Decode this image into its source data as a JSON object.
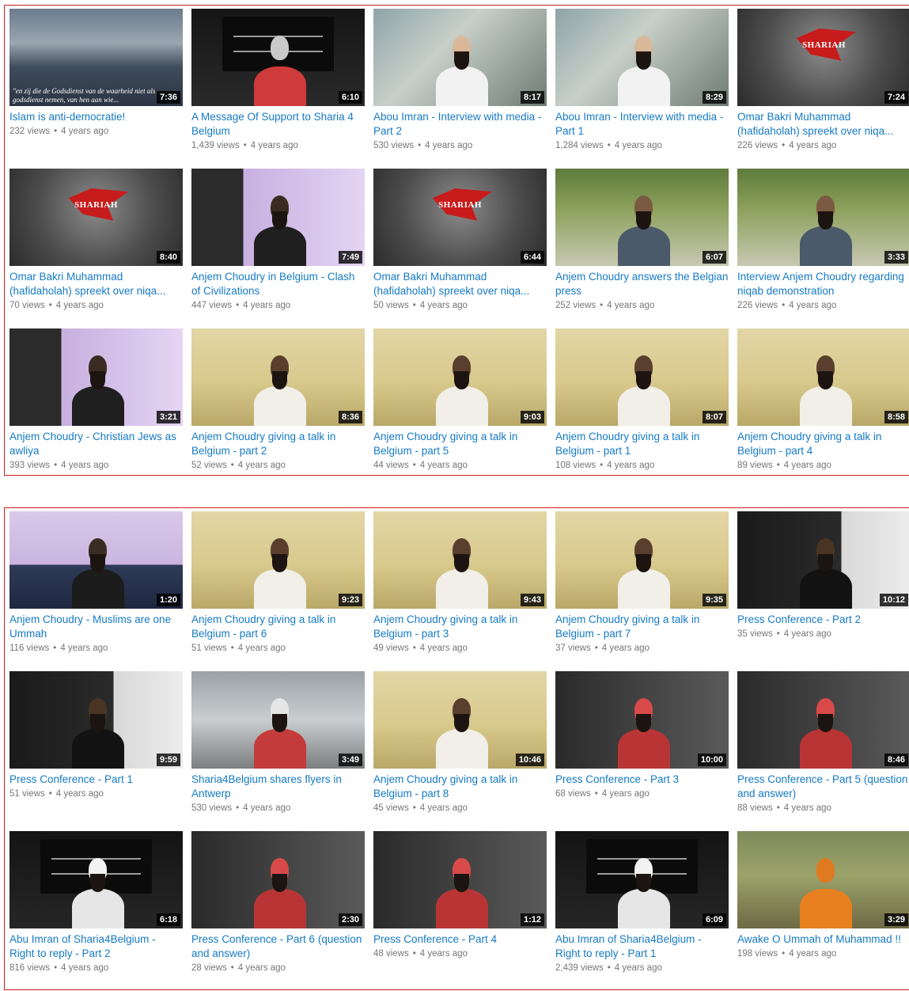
{
  "colors": {
    "border": "#cc1f1f",
    "link": "#167ac6",
    "meta": "#767676",
    "duration_bg": "#000000"
  },
  "sections": [
    {
      "videos": [
        {
          "title": "Islam is anti-democratie!",
          "views": "232 views",
          "age": "4 years ago",
          "duration": "7:36",
          "thumb": "parliament",
          "caption": "\"en zij die de Godsdienst van de waarheid niet als godsdienst nemen, van hen aan wie..."
        },
        {
          "title": "A Message Of Support to Sharia 4 Belgium",
          "views": "1,439 views",
          "age": "4 years ago",
          "duration": "6:10",
          "thumb": "flag-red-scarf"
        },
        {
          "title": "Abou Imran - Interview with media - Part 2",
          "views": "530 views",
          "age": "4 years ago",
          "duration": "8:17",
          "thumb": "interview-street"
        },
        {
          "title": "Abou Imran - Interview with media - Part 1",
          "views": "1,284 views",
          "age": "4 years ago",
          "duration": "8:29",
          "thumb": "interview-street"
        },
        {
          "title": "Omar Bakri Muhammad (hafidaholah) spreekt over niqa...",
          "views": "226 views",
          "age": "4 years ago",
          "duration": "7:24",
          "thumb": "logo",
          "logo_text": "SHARIAH"
        },
        {
          "title": "Omar Bakri Muhammad (hafidaholah) spreekt over niqa...",
          "views": "70 views",
          "age": "4 years ago",
          "duration": "8:40",
          "thumb": "logo",
          "logo_text": "SHARIAH"
        },
        {
          "title": "Anjem Choudry in Belgium - Clash of Civilizations",
          "views": "447 views",
          "age": "4 years ago",
          "duration": "7:49",
          "thumb": "purple-room"
        },
        {
          "title": "Omar Bakri Muhammad (hafidaholah) spreekt over niqa...",
          "views": "50 views",
          "age": "4 years ago",
          "duration": "6:44",
          "thumb": "logo",
          "logo_text": "SHARIAH"
        },
        {
          "title": "Anjem Choudry answers the Belgian press",
          "views": "252 views",
          "age": "4 years ago",
          "duration": "6:07",
          "thumb": "garden"
        },
        {
          "title": "Interview Anjem Choudry regarding niqab demonstration",
          "views": "226 views",
          "age": "4 years ago",
          "duration": "3:33",
          "thumb": "garden"
        },
        {
          "title": "Anjem Choudry - Christian Jews as awliya",
          "views": "393 views",
          "age": "4 years ago",
          "duration": "3:21",
          "thumb": "purple-room"
        },
        {
          "title": "Anjem Choudry giving a talk in Belgium - part 2",
          "views": "52 views",
          "age": "4 years ago",
          "duration": "8:36",
          "thumb": "sofa"
        },
        {
          "title": "Anjem Choudry giving a talk in Belgium - part 5",
          "views": "44 views",
          "age": "4 years ago",
          "duration": "9:03",
          "thumb": "sofa"
        },
        {
          "title": "Anjem Choudry giving a talk in Belgium - part 1",
          "views": "108 views",
          "age": "4 years ago",
          "duration": "8:07",
          "thumb": "sofa"
        },
        {
          "title": "Anjem Choudry giving a talk in Belgium - part 4",
          "views": "89 views",
          "age": "4 years ago",
          "duration": "8:58",
          "thumb": "sofa"
        }
      ]
    },
    {
      "videos": [
        {
          "title": "Anjem Choudry - Muslims are one Ummah",
          "views": "116 views",
          "age": "4 years ago",
          "duration": "1:20",
          "thumb": "press-table"
        },
        {
          "title": "Anjem Choudry giving a talk in Belgium - part 6",
          "views": "51 views",
          "age": "4 years ago",
          "duration": "9:23",
          "thumb": "sofa"
        },
        {
          "title": "Anjem Choudry giving a talk in Belgium - part 3",
          "views": "49 views",
          "age": "4 years ago",
          "duration": "9:43",
          "thumb": "sofa"
        },
        {
          "title": "Anjem Choudry giving a talk in Belgium - part 7",
          "views": "37 views",
          "age": "4 years ago",
          "duration": "9:35",
          "thumb": "sofa"
        },
        {
          "title": "Press Conference - Part 2",
          "views": "35 views",
          "age": "4 years ago",
          "duration": "10:12",
          "thumb": "flag-dark"
        },
        {
          "title": "Press Conference - Part 1",
          "views": "51 views",
          "age": "4 years ago",
          "duration": "9:59",
          "thumb": "flag-dark"
        },
        {
          "title": "Sharia4Belgium shares flyers in Antwerp",
          "views": "530 views",
          "age": "4 years ago",
          "duration": "3:49",
          "thumb": "street-red"
        },
        {
          "title": "Anjem Choudry giving a talk in Belgium - part 8",
          "views": "45 views",
          "age": "4 years ago",
          "duration": "10:46",
          "thumb": "sofa"
        },
        {
          "title": "Press Conference - Part 3",
          "views": "68 views",
          "age": "4 years ago",
          "duration": "10:00",
          "thumb": "red-scarf-close"
        },
        {
          "title": "Press Conference - Part 5 (question and answer)",
          "views": "88 views",
          "age": "4 years ago",
          "duration": "8:46",
          "thumb": "red-scarf-close"
        },
        {
          "title": "Abu Imran of Sharia4Belgium - Right to reply - Part 2",
          "views": "816 views",
          "age": "4 years ago",
          "duration": "6:18",
          "thumb": "flag-white-scarf"
        },
        {
          "title": "Press Conference - Part 6 (question and answer)",
          "views": "28 views",
          "age": "4 years ago",
          "duration": "2:30",
          "thumb": "red-scarf-close"
        },
        {
          "title": "Press Conference - Part 4",
          "views": "48 views",
          "age": "4 years ago",
          "duration": "1:12",
          "thumb": "red-scarf-close"
        },
        {
          "title": "Abu Imran of Sharia4Belgium - Right to reply - Part 1",
          "views": "2,439 views",
          "age": "4 years ago",
          "duration": "6:09",
          "thumb": "flag-white-scarf"
        },
        {
          "title": "Awake O Ummah of Muhammad !!",
          "views": "198 views",
          "age": "4 years ago",
          "duration": "3:29",
          "thumb": "field"
        }
      ]
    }
  ]
}
